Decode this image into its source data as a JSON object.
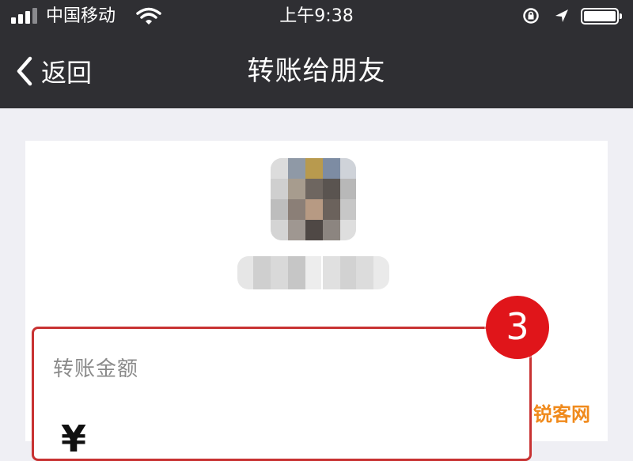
{
  "status_bar": {
    "carrier": "中国移动",
    "time": "上午9:38",
    "signal_icon": "signal-bars-icon",
    "wifi_icon": "wifi-icon",
    "lock_icon": "rotation-lock-icon",
    "location_icon": "location-arrow-icon",
    "battery_icon": "battery-icon"
  },
  "nav": {
    "back_label": "返回",
    "back_icon": "chevron-left-icon",
    "title": "转账给朋友"
  },
  "recipient": {
    "avatar": "blurred-avatar",
    "name": "blurred-name"
  },
  "transfer": {
    "amount_label": "转账金额",
    "currency_symbol": "¥",
    "amount_value": ""
  },
  "annotation": {
    "step_number": "3"
  },
  "watermark": {
    "text": "锐客网"
  },
  "colors": {
    "nav_bg": "#2f2f33",
    "page_bg": "#efeff4",
    "highlight_border": "#c83232",
    "badge_red": "#e0151a",
    "watermark_orange": "#f08a1c"
  }
}
